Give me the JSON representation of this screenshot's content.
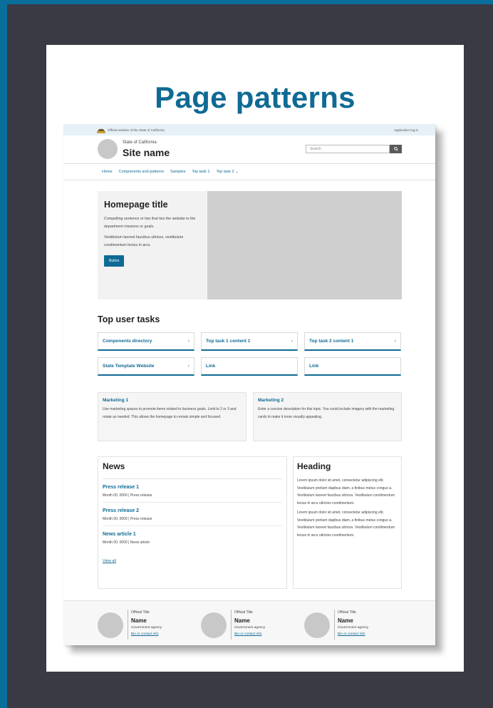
{
  "poster": {
    "title": "Page patterns"
  },
  "topbar": {
    "official": "Official website of the State of California",
    "login": "Application log in"
  },
  "header": {
    "state": "State of California",
    "site": "Site name",
    "search_placeholder": "Search"
  },
  "nav": {
    "items": [
      "Home",
      "Components and patterns",
      "Samples",
      "Top task 1",
      "Top task 2"
    ]
  },
  "homepage": {
    "title": "Homepage title",
    "text1": "Compelling sentence or two that ties the website to the department missions or goals.",
    "text2": "Vestibulum laoreet faucibus ultrices, vestibulum condimentum lectus in arcu.",
    "button": "Button"
  },
  "tasks": {
    "title": "Top user tasks",
    "items": [
      "Components directory",
      "Top task 1 content 1",
      "Top task 2 content 1",
      "State Template Website",
      "Link",
      "Link"
    ]
  },
  "marketing": [
    {
      "title": "Marketing 1",
      "text": "Use marketing spaces to promote items related to business goals. Limit to 2 or 3 and rotate as needed. This allows the homepage to remain simple and focused."
    },
    {
      "title": "Marketing 2",
      "text": "Enter a concise description for this topic. You could include imagery with the marketing cards to make it more visually appealing."
    }
  ],
  "news": {
    "title": "News",
    "items": [
      {
        "title": "Press release 1",
        "meta": "Month 00, 0000 | Press release"
      },
      {
        "title": "Press release 2",
        "meta": "Month 00, 0000 | Press release"
      },
      {
        "title": "News article 1",
        "meta": "Month 00, 0000 | News article"
      }
    ],
    "view_all": "View all"
  },
  "side": {
    "title": "Heading",
    "p1": "Lorem ipsum dolor sit amet, consectetur adipiscing elit. Vestibulum pretium dapibus diam, a finibus metus congue a. Vestibulum laoreet faucibus ultrices. Vestibulum condimentum lectus in arcu ultricies condimentum.",
    "p2": "Lorem ipsum dolor sit amet, consectetur adipiscing elit. Vestibulum pretium dapibus diam, a finibus metus congue a. Vestibulum laoreet faucibus ultrices. Vestibulum condimentum lectus in arcu ultricies condimentum."
  },
  "officials": [
    {
      "title": "Official Title",
      "name": "Name",
      "agency": "Government agency",
      "bio": "Bio or contact info"
    },
    {
      "title": "Official Title",
      "name": "Name",
      "agency": "Government agency",
      "bio": "Bio or contact info"
    },
    {
      "title": "Official Title",
      "name": "Name",
      "agency": "Government agency",
      "bio": "Bio or contact info"
    }
  ],
  "colors": {
    "brand": "#0f6a94",
    "frame": "#3a3a44",
    "outer": "#0a6e9b"
  }
}
